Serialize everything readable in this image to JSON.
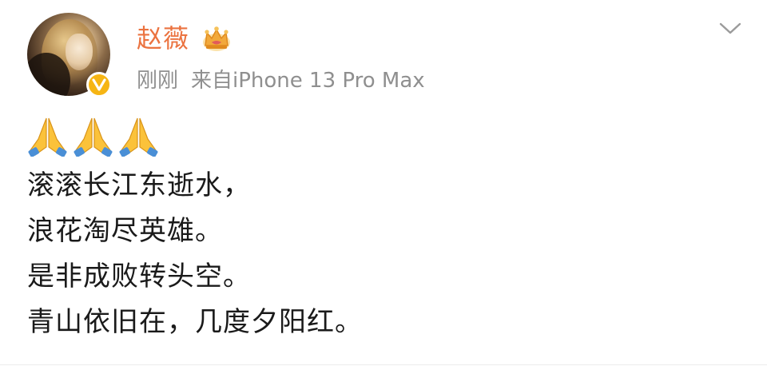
{
  "post": {
    "author": {
      "name": "赵薇",
      "badge_icon": "crown-icon",
      "verified_icon": "verified-v-icon",
      "verified_color": "#f6b514",
      "name_color": "#eb7340"
    },
    "meta": {
      "time": "刚刚",
      "source": "来自iPhone 13 Pro Max"
    },
    "menu_icon": "chevron-down-icon",
    "emojis": [
      "folded-hands-icon",
      "folded-hands-icon",
      "folded-hands-icon"
    ],
    "lines": [
      "滚滚长江东逝水，",
      "浪花淘尽英雄。",
      "是非成败转头空。",
      "青山依旧在，几度夕阳红。"
    ]
  }
}
